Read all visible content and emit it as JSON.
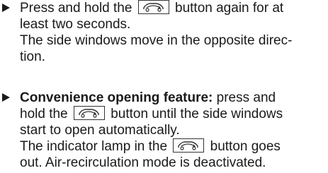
{
  "step1": {
    "line1_a": "Press and hold the",
    "line1_b": "button again for at",
    "line2": "least two seconds.",
    "line3": "The side windows move in the opposite direc-",
    "line4": "tion."
  },
  "step2": {
    "bold_lead": "Convenience opening feature:",
    "line1_b": " press and",
    "line2_a": "hold the",
    "line2_b": "button until the side windows",
    "line3": "start to open automatically.",
    "line4_a": "The indicator lamp in the",
    "line4_b": "button goes",
    "line5": "out. Air-recirculation mode is deactivated."
  },
  "icons": {
    "bullet": "triangle-right-icon",
    "button": "air-recirculation-car-icon"
  }
}
